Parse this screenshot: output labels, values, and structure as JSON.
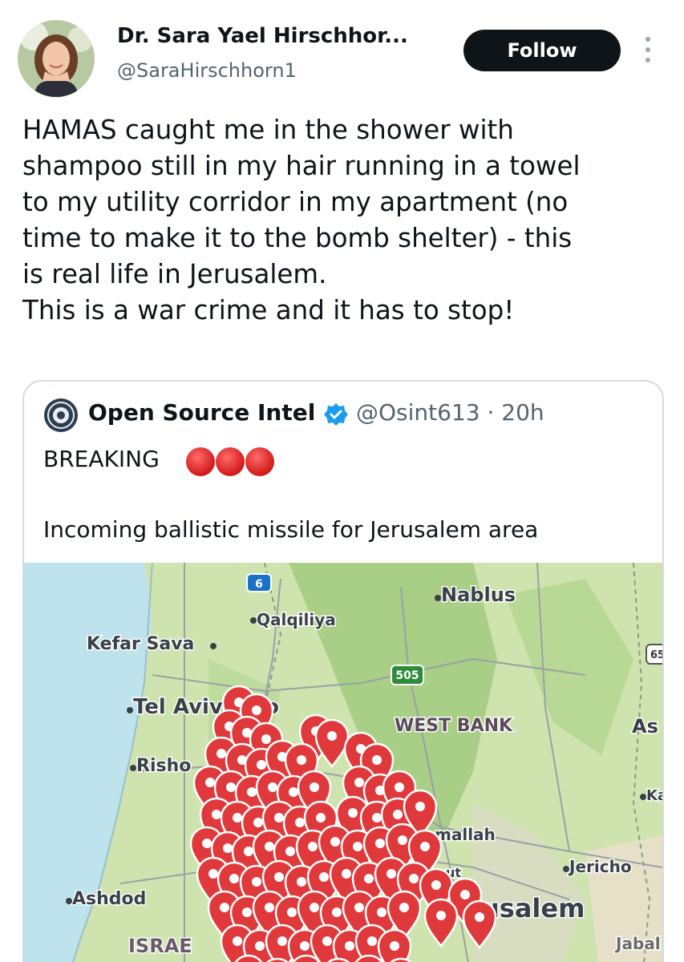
{
  "author": {
    "name": "Dr. Sara Yael Hirschhor...",
    "handle": "@SaraHirschhorn1",
    "follow_label": "Follow"
  },
  "tweet": {
    "text": "HAMAS caught me in the shower with\nshampoo still in my hair running in a towel\nto my utility corridor in my apartment (no\ntime to make it to the bomb shelter) - this\nis real life in Jerusalem.\nThis is a war crime and it has to stop!"
  },
  "quoted_tweet": {
    "name": "Open Source Intel",
    "handle_time": "@Osint613 · 20h",
    "line1": "BREAKING",
    "line2": "Incoming ballistic missile for Jerusalem area",
    "verified_color": "#1d9bf0"
  },
  "map": {
    "labels": {
      "nablus": "Nablus",
      "qalqiliya": "Qalqiliya",
      "kefar_sava": "Kefar Sava",
      "tel_aviv": "Tel Aviv-Yafo",
      "west_bank": "WEST BANK",
      "rishon": "Risho",
      "ramallah": "mallah",
      "jericho": "Jericho",
      "ashdod": "Ashdod",
      "jerusalem": "usalem",
      "israel": "ISRAE",
      "jabal": "Jabal",
      "as": "As",
      "ka": "Ka",
      "ut": "ut",
      "road6": "6",
      "road505": "505",
      "road65": "65"
    },
    "pin_color": "#e0393b"
  }
}
